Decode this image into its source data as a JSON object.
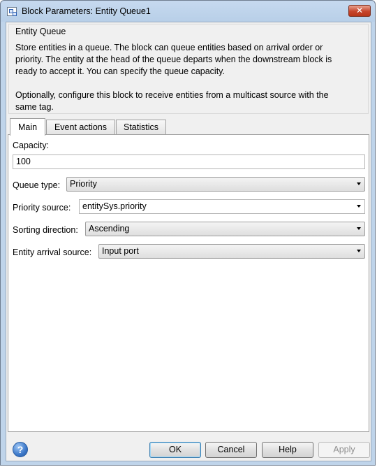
{
  "window": {
    "title": "Block Parameters: Entity Queue1",
    "close_label": "✕"
  },
  "description": {
    "title": "Entity Queue",
    "text": "Store entities in a queue. The block can queue entities based on arrival order or\npriority. The entity at the head of the queue departs when the downstream block is\nready to accept it. You can specify the queue capacity.\n\nOptionally, configure this block to receive entities from a multicast source with the\nsame tag."
  },
  "tabs": [
    {
      "label": "Main"
    },
    {
      "label": "Event actions"
    },
    {
      "label": "Statistics"
    }
  ],
  "main": {
    "capacity_label": "Capacity:",
    "capacity_value": "100",
    "queue_type_label": "Queue type:",
    "queue_type_value": "Priority",
    "priority_source_label": "Priority source:",
    "priority_source_value": "entitySys.priority",
    "sorting_direction_label": "Sorting direction:",
    "sorting_direction_value": "Ascending",
    "entity_arrival_label": "Entity arrival source:",
    "entity_arrival_value": "Input port"
  },
  "buttons": {
    "help_icon": "?",
    "ok": "OK",
    "cancel": "Cancel",
    "help": "Help",
    "apply": "Apply"
  }
}
